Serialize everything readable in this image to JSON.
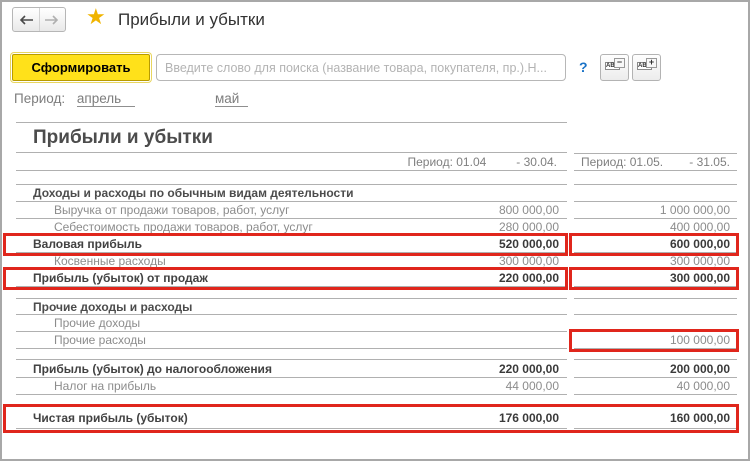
{
  "header": {
    "title": "Прибыли и убытки",
    "star_icon": "★"
  },
  "toolbar": {
    "generate_label": "Сформировать",
    "search_value": "",
    "search_placeholder": "Введите слово для поиска (название товара, покупателя, пр.).Н...",
    "help_label": "?",
    "font_buttons": [
      {
        "letters": "ABC",
        "badge": "−"
      },
      {
        "letters": "ABC",
        "badge": "+"
      }
    ]
  },
  "period_bar": {
    "label": "Период:",
    "month_links": [
      "апрель",
      "май"
    ]
  },
  "report": {
    "title": "Прибыли и убытки",
    "highlight_color": "#e0261c",
    "column_headers": [
      {
        "from": "Период: 01.04",
        "to": "- 30.04."
      },
      {
        "from": "Период: 01.05.",
        "to": "- 31.05."
      }
    ],
    "rows": [
      {
        "type": "blank",
        "h": 14
      },
      {
        "type": "section",
        "label": "Доходы и расходы по обычным видам деятельности",
        "v1": "",
        "v2": "",
        "h": 17
      },
      {
        "type": "item",
        "label": "Выручка от продажи товаров, работ, услуг",
        "v1": "800 000,00",
        "v2": "1 000 000,00",
        "h": 17
      },
      {
        "type": "item",
        "label": "Себестоимость продажи товаров, работ, услуг",
        "v1": "280 000,00",
        "v2": "400 000,00",
        "h": 17
      },
      {
        "type": "total",
        "label": "Валовая прибыль",
        "v1": "520 000,00",
        "v2": "600 000,00",
        "h": 17,
        "highlight": "both"
      },
      {
        "type": "item",
        "label": "Косвенные расходы",
        "v1": "300 000,00",
        "v2": "300 000,00",
        "h": 17
      },
      {
        "type": "total",
        "label": "Прибыль (убыток) от продаж",
        "v1": "220 000,00",
        "v2": "300 000,00",
        "h": 17,
        "highlight": "both"
      },
      {
        "type": "blank",
        "h": 12
      },
      {
        "type": "section",
        "label": "Прочие доходы и расходы",
        "v1": "",
        "v2": "",
        "h": 16
      },
      {
        "type": "item",
        "label": "Прочие доходы",
        "v1": "",
        "v2": "",
        "h": 17
      },
      {
        "type": "item",
        "label": "Прочие расходы",
        "v1": "",
        "v2": "100 000,00",
        "h": 17,
        "highlight": "cell2"
      },
      {
        "type": "blank",
        "h": 11
      },
      {
        "type": "total",
        "label": "Прибыль (убыток) до налогообложения",
        "v1": "220 000,00",
        "v2": "200 000,00",
        "h": 18
      },
      {
        "type": "item",
        "label": "Налог на прибыль",
        "v1": "44 000,00",
        "v2": "40 000,00",
        "h": 17
      },
      {
        "type": "blank",
        "h": 13,
        "noborder": true
      },
      {
        "type": "total",
        "label": "Чистая прибыль (убыток)",
        "v1": "176 000,00",
        "v2": "160 000,00",
        "h": 21,
        "highlight": "full"
      }
    ]
  }
}
